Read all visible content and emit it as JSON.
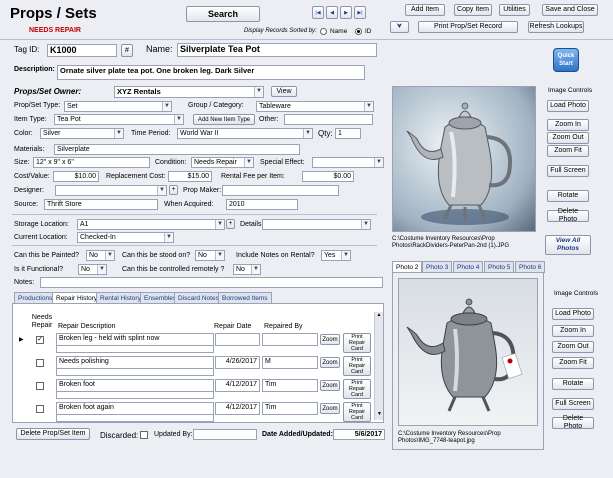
{
  "header": {
    "title": "Props / Sets",
    "status": "NEEDS REPAIR",
    "search_label": "Search",
    "sort_label": "Display Records Sorted by:",
    "sort_options": [
      "Name",
      "ID"
    ],
    "nav": [
      "|◀",
      "◀",
      "▶",
      "▶|"
    ]
  },
  "toolbar": {
    "add_item": "Add Item",
    "copy_item": "Copy Item",
    "utilities": "Utilities",
    "save_close": "Save and Close",
    "print_record": "Print Prop/Set Record",
    "refresh_lookups": "Refresh Lookups",
    "quick_start": "Quick Start"
  },
  "record": {
    "tag_label": "Tag ID:",
    "tag_value": "K1000",
    "hash_btn": "#",
    "name_label": "Name:",
    "name_value": "Silverplate Tea Pot",
    "desc_label": "Description:",
    "desc_value": "Ornate silver plate tea pot.  One broken leg. Dark Silver",
    "owner_label": "Props/Set Owner:",
    "owner_value": "XYZ Rentals",
    "view_btn": "View",
    "type_label": "Prop/Set Type:",
    "type_value": "Set",
    "group_label": "Group / Category:",
    "group_value": "Tableware",
    "newtype_btn": "Add New Item Type",
    "itemtype_label": "Item Type:",
    "itemtype_value": "Tea Pot",
    "other_label": "Other:",
    "color_label": "Color:",
    "color_value": "Silver",
    "period_label": "Time Period:",
    "period_value": "World War II",
    "qty_label": "Qty:",
    "qty_value": "1",
    "materials_label": "Materials:",
    "materials_value": "Silverplate",
    "size_label": "Size:",
    "size_value": "12\" x 9\" x 6\"",
    "condition_label": "Condition:",
    "condition_value": "Needs Repair",
    "effect_label": "Special Effect:",
    "cost_label": "Cost/Value:",
    "cost_value": "$10.00",
    "replace_label": "Replacement Cost:",
    "replace_value": "$15.00",
    "rental_label": "Rental Fee per Item:",
    "rental_value": "$0.00",
    "designer_label": "Designer:",
    "maker_label": "Prop Maker:",
    "source_label": "Source:",
    "source_value": "Thrift Store",
    "acquired_label": "When Acquired:",
    "acquired_value": "2010",
    "storage_label": "Storage Location:",
    "storage_value": "A1",
    "details_label": "Details:",
    "current_label": "Current Location:",
    "current_value": "Checked-In",
    "painted_label": "Can this be Painted?",
    "painted_value": "No",
    "stood_label": "Can this be stood on?",
    "stood_value": "No",
    "notes_rental_label": "Include Notes on Rental?",
    "notes_rental_value": "Yes",
    "functional_label": "Is it Functional?",
    "functional_value": "No",
    "remote_label": "Can this be controlled remotely ?",
    "remote_value": "No",
    "notes_label": "Notes:"
  },
  "tabs": [
    "Productions",
    "Repair History",
    "Rental History",
    "Ensembles",
    "Discard Notes",
    "Borrowed Items"
  ],
  "repair": {
    "headers": {
      "needs": "Needs Repair",
      "desc": "Repair Description",
      "date": "Repair Date",
      "by": "Repaired By"
    },
    "zoom": "Zoom",
    "print": "Print Repair Card",
    "rows": [
      {
        "checked": "✓",
        "desc": "Broken leg - held with splint now",
        "date": "",
        "by": ""
      },
      {
        "checked": "",
        "desc": "Needs polishing",
        "date": "4/26/2017",
        "by": "M"
      },
      {
        "checked": "",
        "desc": "Broken foot",
        "date": "4/12/2017",
        "by": "Tim"
      },
      {
        "checked": "",
        "desc": "Broken foot again",
        "date": "4/12/2017",
        "by": "Tim"
      }
    ]
  },
  "footer": {
    "delete_btn": "Delete Prop/Set Item",
    "discarded_label": "Discarded:",
    "updated_label": "Updated By:",
    "added_label": "Date Added/Updated:",
    "added_value": "5/6/2017"
  },
  "photo1": {
    "path": "C:\\Costume Inventory Resources\\Prop Photos\\RackDividers-PeterPan-2nd (1).JPG",
    "controls_title": "Image Controls",
    "load": "Load Photo",
    "zoom_in": "Zoom In",
    "zoom_out": "Zoom Out",
    "zoom_fit": "Zoom Fit",
    "full": "Full Screen",
    "rotate": "Rotate",
    "delete": "Delete Photo",
    "view_all": "View All Photos"
  },
  "photo_tabs": [
    "Photo 2",
    "Photo 3",
    "Photo 4",
    "Photo 5",
    "Photo 6"
  ],
  "photo2": {
    "path": "C:\\Costume Inventory Resources\\Prop Photos\\IMG_7748-teapot.jpg",
    "controls_title": "Image Controls",
    "load": "Load Photo",
    "zoom_in": "Zoom In",
    "zoom_out": "Zoom Out",
    "zoom_fit": "Zoom Fit",
    "rotate": "Rotate",
    "full": "Full Screen",
    "delete": "Delete Photo"
  },
  "colors": {
    "accent_red": "#c00000",
    "link_blue": "#1a3a8c"
  }
}
